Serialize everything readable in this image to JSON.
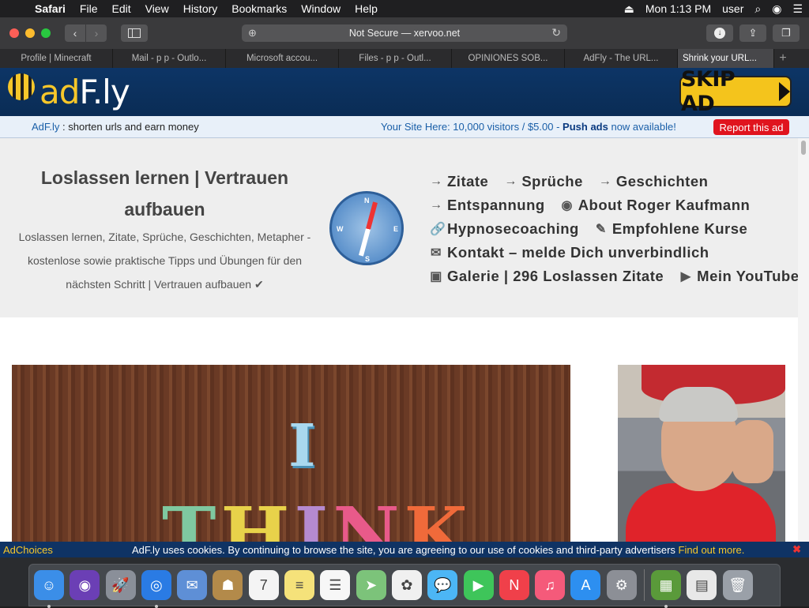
{
  "menubar": {
    "app": "Safari",
    "items": [
      "File",
      "Edit",
      "View",
      "History",
      "Bookmarks",
      "Window",
      "Help"
    ],
    "clock": "Mon 1:13 PM",
    "user": "user"
  },
  "toolbar": {
    "url_text": "Not Secure — xervoo.net"
  },
  "tabs": [
    {
      "label": "Profile | Minecraft"
    },
    {
      "label": "Mail - p p - Outlo..."
    },
    {
      "label": "Microsoft accou..."
    },
    {
      "label": "Files - p p - Outl..."
    },
    {
      "label": "OPINIONES SOB..."
    },
    {
      "label": "AdFly - The URL..."
    },
    {
      "label": "Shrink your URL..."
    }
  ],
  "adfly": {
    "logo_ad": "ad",
    "logo_rest": "F.ly",
    "skip_label": "SKIP AD",
    "info_brand": "AdF.ly",
    "info_text": ": shorten urls and earn money",
    "promo_text": "Your Site Here: 10,000 visitors / $5.00 -",
    "promo_bold": "Push ads",
    "promo_end": "now available!",
    "report_label": "Report this ad"
  },
  "site": {
    "title": "Loslassen lernen | Vertrauen aufbauen",
    "description": "Loslassen lernen, Zitate, Sprüche, Geschichten, Metapher - kostenlose sowie praktische Tipps und Übungen für den nächsten Schritt | Vertrauen aufbauen ✔",
    "compass_letters": {
      "n": "N",
      "s": "S",
      "w": "W",
      "e": "E"
    },
    "nav_rows": [
      [
        {
          "icon": "→",
          "label": "Zitate"
        },
        {
          "icon": "→",
          "label": "Sprüche"
        },
        {
          "icon": "→",
          "label": "Geschichten"
        }
      ],
      [
        {
          "icon": "→",
          "label": "Entspannung"
        },
        {
          "icon": "◉",
          "label": "About Roger Kaufmann"
        }
      ],
      [
        {
          "icon": "🔗",
          "label": "Hypnosecoaching"
        },
        {
          "icon": "✎",
          "label": "Empfohlene Kurse"
        }
      ],
      [
        {
          "icon": "✉",
          "label": "Kontakt – melde Dich unverbindlich"
        }
      ],
      [
        {
          "icon": "▣",
          "label": "Galerie | 296 Loslassen Zitate"
        },
        {
          "icon": "▶",
          "label": "Mein YouTube"
        }
      ]
    ],
    "photo_letters_top": "I",
    "photo_letters_word": [
      "T",
      "H",
      "I",
      "N",
      "K"
    ],
    "photo_letter_colors": [
      "#7fc8a0",
      "#e8d24a",
      "#b58ad0",
      "#e85a8a",
      "#f06a3a"
    ]
  },
  "cookie": {
    "adchoices": "AdChoices",
    "text": "AdF.ly uses cookies. By continuing to browse the site, you are agreeing to our use of cookies and third-party advertisers",
    "link": "Find out more.",
    "close": "✖"
  },
  "dock": [
    {
      "name": "finder-icon",
      "bg": "#3b8ee8",
      "glyph": "☺",
      "running": true
    },
    {
      "name": "siri-icon",
      "bg": "#6b3fb5",
      "glyph": "◉",
      "running": false
    },
    {
      "name": "launchpad-icon",
      "bg": "#8a8f99",
      "glyph": "🚀",
      "running": false
    },
    {
      "name": "safari-icon",
      "bg": "#2a7be4",
      "glyph": "◎",
      "running": true
    },
    {
      "name": "mail-icon",
      "bg": "#5e8fd6",
      "glyph": "✉",
      "running": false
    },
    {
      "name": "contacts-icon",
      "bg": "#b38a4a",
      "glyph": "☗",
      "running": false
    },
    {
      "name": "calendar-icon",
      "bg": "#f4f4f4",
      "glyph": "7",
      "running": false
    },
    {
      "name": "notes-icon",
      "bg": "#f5e27a",
      "glyph": "≡",
      "running": false
    },
    {
      "name": "reminders-icon",
      "bg": "#f7f7f7",
      "glyph": "☰",
      "running": false
    },
    {
      "name": "maps-icon",
      "bg": "#7cc37a",
      "glyph": "➤",
      "running": false
    },
    {
      "name": "photos-icon",
      "bg": "#f0f0f0",
      "glyph": "✿",
      "running": false
    },
    {
      "name": "messages-icon",
      "bg": "#4cb6f5",
      "glyph": "💬",
      "running": false
    },
    {
      "name": "facetime-icon",
      "bg": "#3ec55a",
      "glyph": "▶",
      "running": false
    },
    {
      "name": "news-icon",
      "bg": "#f0404a",
      "glyph": "N",
      "running": false
    },
    {
      "name": "music-icon",
      "bg": "#f55a7a",
      "glyph": "♫",
      "running": false
    },
    {
      "name": "app-store-icon",
      "bg": "#2d8ff0",
      "glyph": "A",
      "running": false
    },
    {
      "name": "system-preferences-icon",
      "bg": "#8c8f96",
      "glyph": "⚙",
      "running": false
    },
    {
      "name": "minecraft-icon",
      "bg": "#5a9a3a",
      "glyph": "▦",
      "running": true
    },
    {
      "name": "downloads-stack-icon",
      "bg": "#e8e8e8",
      "glyph": "▤",
      "running": false
    },
    {
      "name": "trash-icon",
      "bg": "#9aa0a8",
      "glyph": "🗑",
      "running": false
    }
  ]
}
